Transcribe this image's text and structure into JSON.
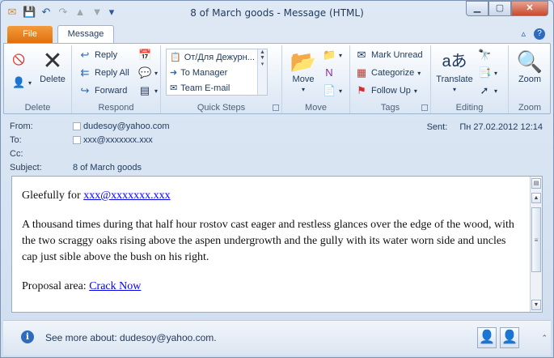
{
  "window": {
    "title": "8 of March goods - Message (HTML)"
  },
  "qat": {
    "save": "save-icon",
    "undo": "undo-icon",
    "redo": "redo-icon"
  },
  "tabs": {
    "file": "File",
    "message": "Message"
  },
  "ribbon": {
    "delete_group": {
      "label": "Delete",
      "delete": "Delete"
    },
    "respond_group": {
      "label": "Respond",
      "reply": "Reply",
      "reply_all": "Reply All",
      "forward": "Forward"
    },
    "quick_steps": {
      "label": "Quick Steps",
      "items": [
        "От/Для Дежурн...",
        "To Manager",
        "Team E-mail"
      ]
    },
    "move_group": {
      "label": "Move",
      "move": "Move"
    },
    "tags_group": {
      "label": "Tags",
      "mark_unread": "Mark Unread",
      "categorize": "Categorize",
      "follow_up": "Follow Up"
    },
    "editing_group": {
      "label": "Editing",
      "translate": "Translate"
    },
    "zoom_group": {
      "label": "Zoom",
      "zoom": "Zoom"
    }
  },
  "header": {
    "from_label": "From:",
    "from": "dudesoy@yahoo.com",
    "to_label": "To:",
    "to": "xxx@xxxxxxx.xxx",
    "cc_label": "Cc:",
    "cc": "",
    "subject_label": "Subject:",
    "subject": "8 of March goods",
    "sent_label": "Sent:",
    "sent": "Пн 27.02.2012 12:14"
  },
  "body": {
    "greeting": "Gleefully for ",
    "greeting_link": "xxx@xxxxxxx.xxx",
    "paragraph": "A thousand times during that half hour rostov cast eager and restless glances over the edge of the wood, with the two scraggy oaks rising above the aspen undergrowth and the gully with its water worn side and uncles cap just sible above the bush on his right.",
    "proposal_label": "Proposal area: ",
    "proposal_link": "Crack Now"
  },
  "people_pane": {
    "see_more": "See more about: dudesoy@yahoo.com."
  }
}
